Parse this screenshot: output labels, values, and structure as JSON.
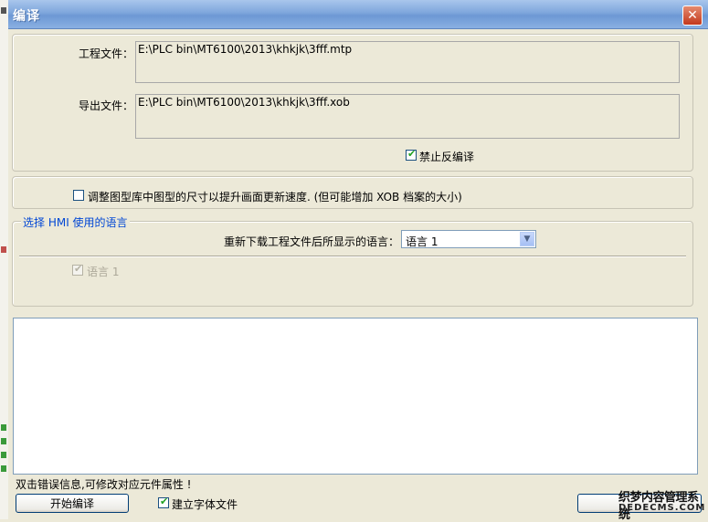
{
  "window": {
    "title": "编译",
    "close_glyph": "✕"
  },
  "project_file": {
    "label": "工程文件：",
    "value": "E:\\PLC bin\\MT6100\\2013\\khkjk\\3fff.mtp"
  },
  "export_file": {
    "label": "导出文件：",
    "value": "E:\\PLC bin\\MT6100\\2013\\khkjk\\3fff.xob"
  },
  "disable_decompile": {
    "label": "禁止反编译",
    "checked": true
  },
  "resize_images": {
    "label": "调整图型库中图型的尺寸以提升画面更新速度. (但可能增加 XOB 档案的大小)",
    "checked": false
  },
  "language_group": {
    "legend": "选择 HMI 使用的语言",
    "display_language_label": "重新下载工程文件后所显示的语言：",
    "display_language_value": "语言 1",
    "language_1": {
      "label": "语言 1",
      "checked": true,
      "disabled": true
    }
  },
  "message_area": {
    "hint": "双击错误信息,可修改对应元件属性 !"
  },
  "footer": {
    "start_button": "开始编译",
    "build_font": {
      "label": "建立字体文件",
      "checked": true
    }
  },
  "watermark": {
    "line1": "织梦内容管理系统",
    "line2": "DEDECMS.COM"
  },
  "icons": {
    "checkbox_tick": "✔",
    "dropdown_arrow": "▼"
  }
}
